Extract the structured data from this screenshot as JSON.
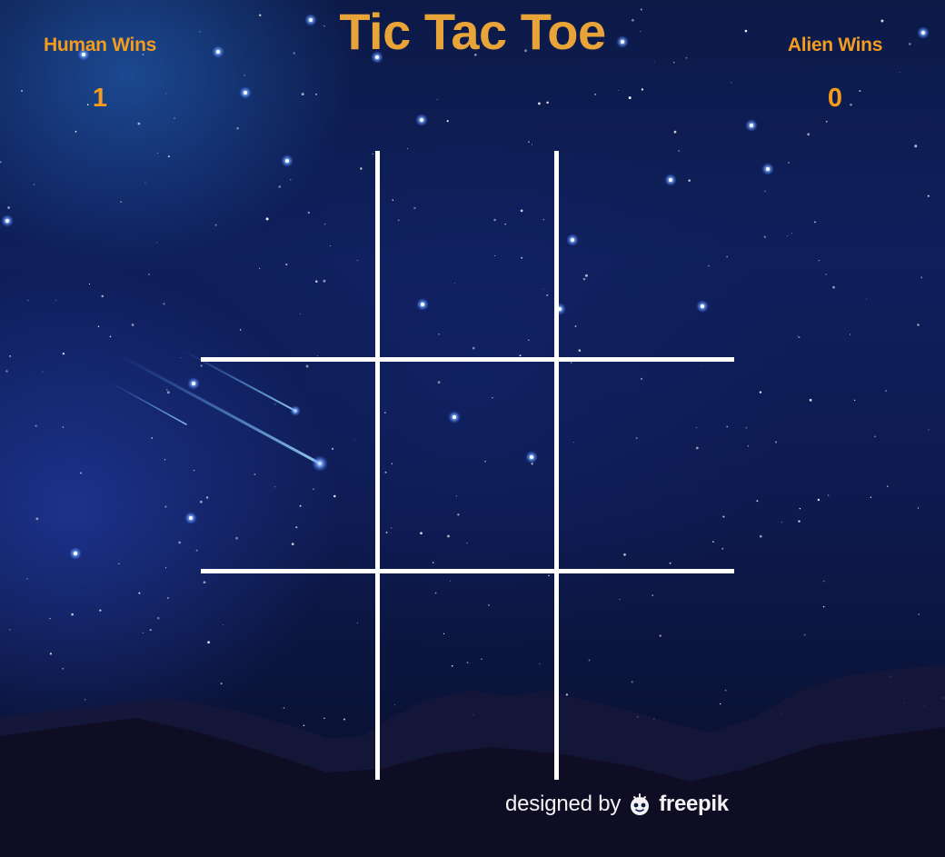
{
  "title": "Tic Tac Toe",
  "scores": {
    "human": {
      "label": "Human Wins",
      "value": "1"
    },
    "alien": {
      "label": "Alien Wins",
      "value": "0"
    }
  },
  "board": {
    "cells": [
      "",
      "",
      "",
      "",
      "",
      "",
      "",
      "",
      ""
    ]
  },
  "credit": {
    "prefix": "designed by",
    "brand": "freepik"
  },
  "colors": {
    "title": "#e8a438",
    "score": "#f39c1e",
    "grid": "#ffffff",
    "sky_top": "#0c1a48",
    "sky_bottom": "#06091d"
  }
}
